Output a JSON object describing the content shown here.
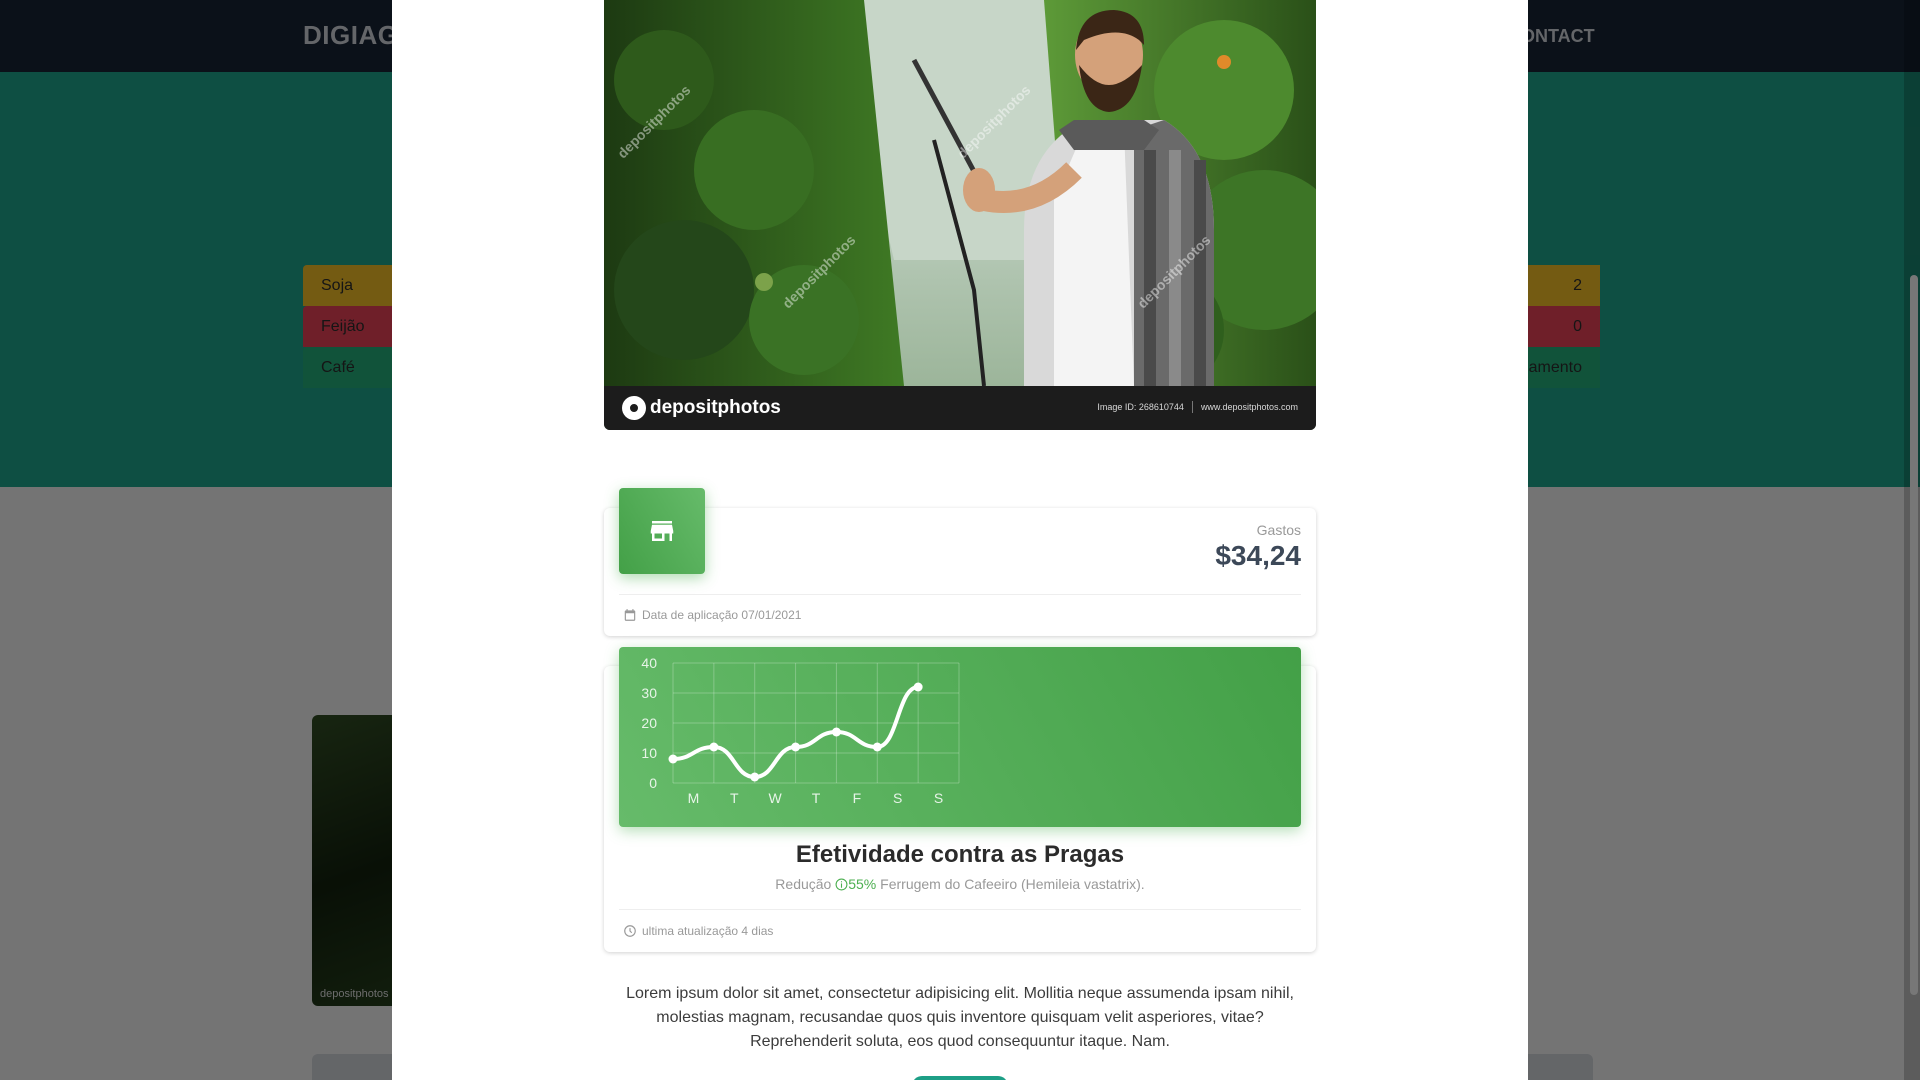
{
  "background": {
    "brand": "DIGIAG",
    "nav_link": "CONTACT",
    "rows": [
      {
        "label": "Soja",
        "value": "2"
      },
      {
        "label": "Feijão",
        "value": "0"
      },
      {
        "label": "Café",
        "value": "amento"
      }
    ],
    "photo_watermark": "depositphotos"
  },
  "modal": {
    "photo": {
      "logo": "depositphotos",
      "image_id": "Image ID: 268610744",
      "site": "www.depositphotos.com",
      "watermark": "depositphotos"
    },
    "stats_card": {
      "icon": "store-icon",
      "category": "Gastos",
      "value": "$34,24",
      "footer_icon": "calendar-icon",
      "footer": "Data de aplicação 07/01/2021"
    },
    "chart_card": {
      "title": "Efetividade contra as Pragas",
      "subtitle_prefix": "Redução",
      "subtitle_icon": "info-icon",
      "subtitle_percent": "55%",
      "subtitle_suffix": "Ferrugem do Cafeeiro (Hemileia vastatrix).",
      "footer_icon": "clock-icon",
      "footer": "ultima atualização 4 dias"
    },
    "description": "Lorem ipsum dolor sit amet, consectetur adipisicing elit. Mollitia neque assumenda ipsam nihil, molestias magnam, recusandae quos quis inventore quisquam velit asperiores, vitae? Reprehenderit soluta, eos quod consequuntur itaque. Nam."
  },
  "colors": {
    "accent_green": "#4caf50",
    "nav_dark": "#172233",
    "hero_teal": "#1d9f86"
  },
  "chart_data": {
    "type": "line",
    "categories": [
      "M",
      "T",
      "W",
      "T",
      "F",
      "S",
      "S"
    ],
    "series": [
      {
        "values": [
          8,
          12,
          2,
          12,
          17,
          12,
          32
        ]
      }
    ],
    "y_ticks": [
      "0",
      "10",
      "20",
      "30",
      "40"
    ],
    "ylim": [
      0,
      40
    ],
    "grid": true
  }
}
